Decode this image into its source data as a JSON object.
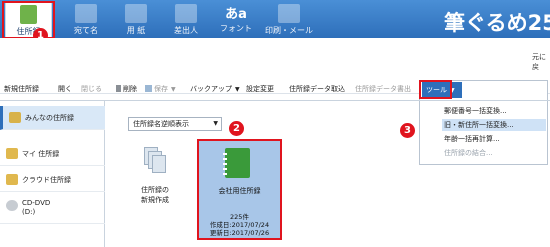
{
  "tabs": [
    {
      "label": "住所録",
      "active": true
    },
    {
      "label": "宛て名"
    },
    {
      "label": "用 紙"
    },
    {
      "label": "差出人"
    },
    {
      "label": "フォント",
      "glyph": "あa"
    },
    {
      "label": "印刷・メール"
    }
  ],
  "brand": "筆ぐるめ25",
  "corner_text": "元に戻",
  "toolbar": {
    "new_book": "新規住所録",
    "open": "開く",
    "close": "閉じる",
    "delete": "削除",
    "save": "保存",
    "backup": "バックアップ",
    "settings": "設定変更",
    "import": "住所録データ取込",
    "export": "住所録データ書出",
    "tools": "ツール"
  },
  "tool_menu": {
    "items": [
      {
        "label": "郵便番号一括変換...",
        "highlight": false,
        "disabled": false
      },
      {
        "label": "旧・新住所一括変換...",
        "highlight": true,
        "disabled": false
      },
      {
        "label": "年齢一括再計算...",
        "highlight": false,
        "disabled": false
      },
      {
        "label": "住所録の結合...",
        "highlight": false,
        "disabled": true
      }
    ]
  },
  "sidebar": {
    "items": [
      {
        "label": "みんなの住所録",
        "selected": true
      },
      {
        "label": "マイ 住所録"
      },
      {
        "label": "クラウド住所録"
      },
      {
        "label": "CD-DVD",
        "sub": "(D:)"
      }
    ]
  },
  "sort_select": "住所録名逆順表示",
  "cards": {
    "new": {
      "line1": "住所録の",
      "line2": "新規作成"
    },
    "company": {
      "name": "会社用住所録",
      "count": "225件",
      "created": "作成日:2017/07/24",
      "updated": "更新日:2017/07/26"
    }
  },
  "callouts": [
    "1",
    "2",
    "3"
  ],
  "colors": {
    "accent": "#2e6fba",
    "highlight": "#e0141e",
    "book": "#3a9a3a"
  }
}
